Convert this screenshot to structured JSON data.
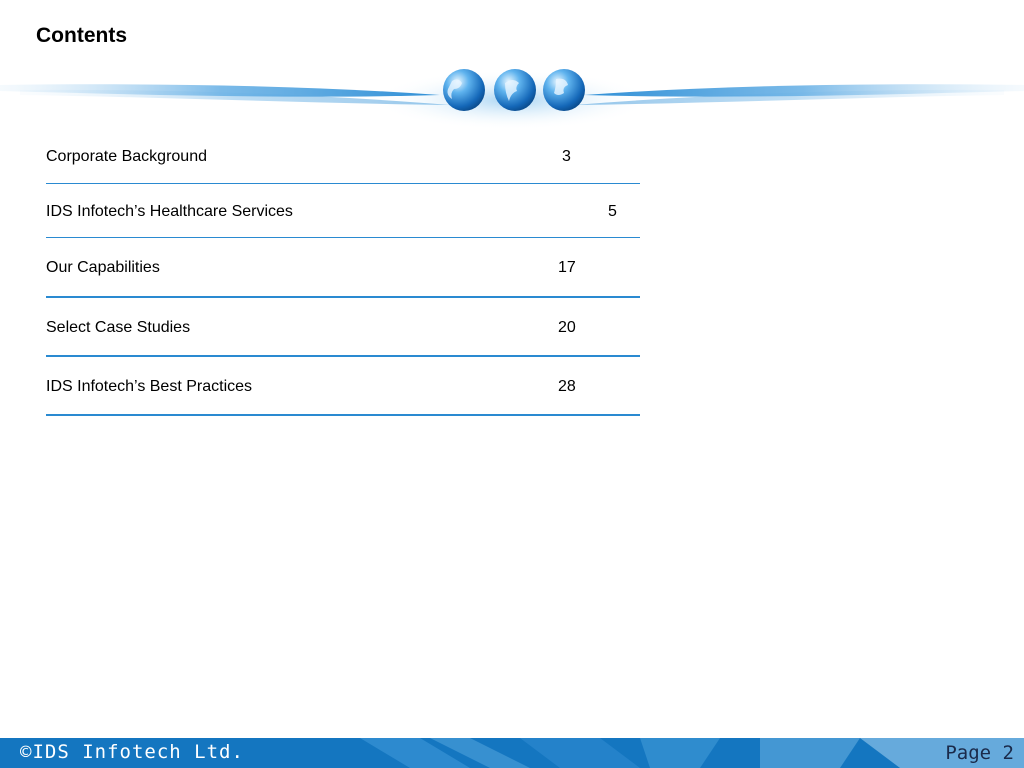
{
  "title": "Contents",
  "toc": [
    {
      "label": "Corporate Background",
      "page": "3"
    },
    {
      "label": "IDS Infotech’s Healthcare Services",
      "page": "5"
    },
    {
      "label": "Our  Capabilities",
      "page": "17"
    },
    {
      "label": "Select Case Studies",
      "page": "20"
    },
    {
      "label": "IDS Infotech’s Best Practices",
      "page": "28"
    }
  ],
  "footer": {
    "copyright": "©IDS Infotech Ltd.",
    "page_label": "Page 2"
  },
  "colors": {
    "accent": "#2a8ad1",
    "footer_bg": "#1476c0"
  }
}
